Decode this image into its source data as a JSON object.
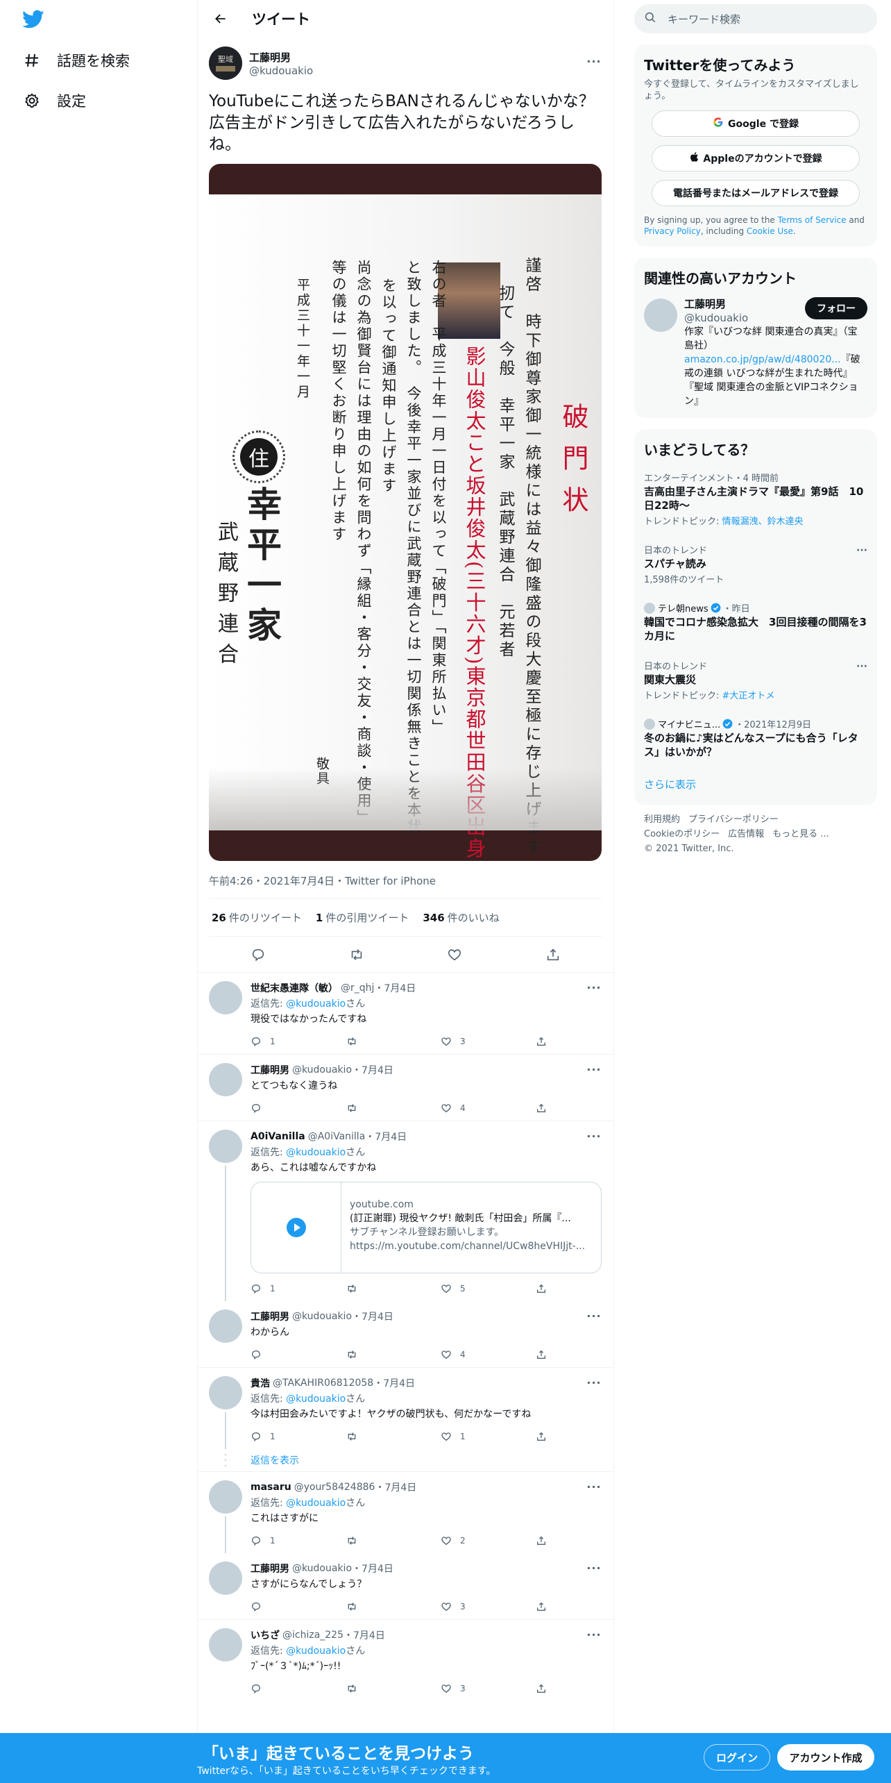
{
  "nav": {
    "explore": "話題を検索",
    "settings": "設定"
  },
  "header": {
    "title": "ツイート"
  },
  "tweet": {
    "author_name": "工藤明男",
    "author_handle": "@kudouakio",
    "text": "YouTubeにこれ送ったらBANされるんじゃないかな？\n広告主がドン引きして広告入れたがらないだろうしね。",
    "meta": "午前4:26・2021年7月4日・Twitter for iPhone",
    "stats": [
      {
        "num": "26",
        "label": "件のリツイート"
      },
      {
        "num": "1",
        "label": "件の引用ツイート"
      },
      {
        "num": "346",
        "label": "件のいいね"
      }
    ],
    "image_text": {
      "col1": "謹啓　時下御尊家御一統様には益々御隆盛の段大慶至極に存じ上げます",
      "col2": "扨て　今般　幸平一家　武蔵野連合　元若者",
      "col3": "影山俊太こと坂井俊太(三十六才)東京都世田谷区出身",
      "col4": "右の者　平成三十年一月一日付を以って「破門」「関東所払い」",
      "col5": "と致しました。　今後幸平一家並びに武蔵野連合とは一切関係無きことを本状",
      "col6": "を以って御通知申し上げます",
      "col7": "尚念の為御賢台には理由の如何を問わず「縁組・客分・交友・商談・使用」",
      "col8": "等の儀は一切堅くお断り申し上げます",
      "date": "平成三十一年一月",
      "title": "破門状",
      "signature": "幸平一家",
      "signature2": "武蔵野連合",
      "crest": "住",
      "closing": "敬具"
    }
  },
  "replies": [
    {
      "name": "世紀末愚連隊（敏）",
      "handle": "@r_qhj",
      "date": "7月4日",
      "replyto_prefix": "返信先: ",
      "replyto": "@kudouakio",
      "replyto_suffix": "さん",
      "text": "現役ではなかったんですね",
      "replies": "1",
      "retweets": "",
      "likes": "3"
    },
    {
      "name": "工藤明男",
      "handle": "@kudouakio",
      "date": "7月4日",
      "text": "とてつもなく違うね",
      "replies": "",
      "retweets": "",
      "likes": "4"
    },
    {
      "name": "A0iVanilla",
      "handle": "@A0iVanilla",
      "date": "7月4日",
      "replyto_prefix": "返信先: ",
      "replyto": "@kudouakio",
      "replyto_suffix": "さん",
      "text": "あら、これは嘘なんですかね",
      "replies": "1",
      "retweets": "",
      "likes": "5",
      "card": {
        "domain": "youtube.com",
        "title": "(訂正謝罪) 現役ヤクザ! 敵刺氏「村田会」所属『...",
        "desc": "サブチャンネル登録お願いします。",
        "url": "https://m.youtube.com/channel/UCw8heVHIJjt-..."
      }
    },
    {
      "name": "工藤明男",
      "handle": "@kudouakio",
      "date": "7月4日",
      "text": "わからん",
      "replies": "",
      "retweets": "",
      "likes": "4"
    },
    {
      "name": "貴浩",
      "handle": "@TAKAHIR06812058",
      "date": "7月4日",
      "replyto_prefix": "返信先: ",
      "replyto": "@kudouakio",
      "replyto_suffix": "さん",
      "text": "今は村田会みたいですよ！ヤクザの破門状も、何だかなーですね",
      "replies": "1",
      "retweets": "",
      "likes": "1"
    },
    {
      "name": "masaru",
      "handle": "@your58424886",
      "date": "7月4日",
      "replyto_prefix": "返信先: ",
      "replyto": "@kudouakio",
      "replyto_suffix": "さん",
      "text": "これはさすがに",
      "replies": "1",
      "retweets": "",
      "likes": "2"
    },
    {
      "name": "工藤明男",
      "handle": "@kudouakio",
      "date": "7月4日",
      "text": "さすがにらなんでしょう？",
      "replies": "",
      "retweets": "",
      "likes": "3"
    },
    {
      "name": "いちざ",
      "handle": "@ichiza_225",
      "date": "7月4日",
      "replyto_prefix": "返信先: ",
      "replyto": "@kudouakio",
      "replyto_suffix": "さん",
      "text": "ﾌﾞｰ(*´３`*)ﾑ;*´)ｰｯ!!",
      "replies": "",
      "retweets": "",
      "likes": "3"
    }
  ],
  "show_replies": "返信を表示",
  "sidebar": {
    "search_placeholder": "キーワード検索",
    "signup": {
      "title": "Twitterを使ってみよう",
      "desc": "今すぐ登録して、タイムラインをカスタマイズしましょう。",
      "google": "Google で登録",
      "apple": "Appleのアカウントで登録",
      "phone": "電話番号またはメールアドレスで登録",
      "legal_1": "By signing up, you agree to the ",
      "legal_tos": "Terms of Service",
      "legal_2": " and ",
      "legal_pp": "Privacy Policy",
      "legal_3": ", including ",
      "legal_cookie": "Cookie Use",
      "legal_4": "."
    },
    "relevant": {
      "title": "関連性の高いアカウント",
      "name": "工藤明男",
      "handle": "@kudouakio",
      "follow": "フォロー",
      "bio_1": "作家『いびつな絆 関東連合の真実』（宝島社）",
      "bio_link": "amazon.co.jp/gp/aw/d/480020...",
      "bio_2": "『破戒の連鎖 いびつな絆が生まれた時代』『聖域 関東連合の金脈とVIPコネクション』"
    },
    "trends": {
      "title": "いまどうしてる？",
      "items": [
        {
          "ctx": "エンターテインメント・4 時間前",
          "title": "吉高由里子さん主演ドラマ『最愛』第9話　10日22時〜",
          "sub_prefix": "トレンドトピック: ",
          "sub_link": "情報漏洩、鈴木達央"
        },
        {
          "ctx": "日本のトレンド",
          "title": "スパチャ読み",
          "sub": "1,598件のツイート"
        },
        {
          "ctx_source": "テレ朝news",
          "ctx_time": "・昨日",
          "title": "韓国でコロナ感染急拡大　3回目接種の間隔を3カ月に"
        },
        {
          "ctx": "日本のトレンド",
          "title": "関東大震災",
          "sub_prefix": "トレンドトピック: ",
          "sub_link": "#大正オトメ"
        },
        {
          "ctx_source": "マイナビニュ...",
          "ctx_time": "・2021年12月9日",
          "title": "冬のお鍋に♪実はどんなスープにも合う「レタス」はいかが？"
        }
      ],
      "show_more": "さらに表示"
    },
    "footer": {
      "links": [
        "利用規約",
        "プライバシーポリシー",
        "Cookieのポリシー",
        "広告情報",
        "もっと見る ..."
      ],
      "copyright": "© 2021 Twitter, Inc."
    }
  },
  "bottombar": {
    "title": "「いま」起きていることを見つけよう",
    "sub": "Twitterなら、「いま」起きていることをいち早くチェックできます。",
    "login": "ログイン",
    "signup": "アカウント作成"
  },
  "colors": {
    "accent": "#1d9bf0",
    "text": "#0f1419",
    "muted": "#536471"
  }
}
